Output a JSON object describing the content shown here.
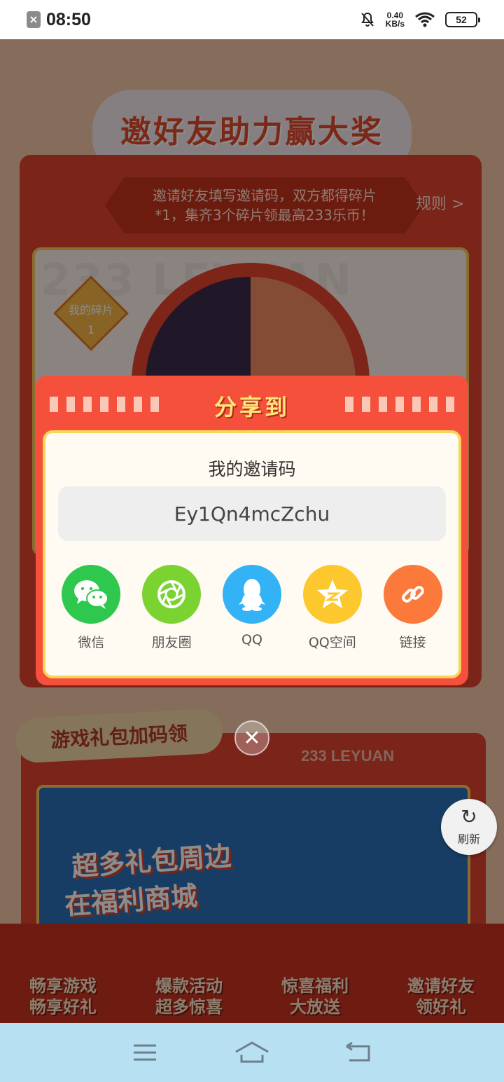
{
  "status_bar": {
    "time": "08:50",
    "net_speed_value": "0.40",
    "net_speed_unit": "KB/s",
    "battery": "52"
  },
  "page": {
    "hero_title": "邀好友助力赢大奖",
    "banner_line1": "邀请好友填写邀请码，双方都得碎片",
    "banner_line2": "*1，集齐3个碎片领最高233乐币！",
    "rules_link": "规则 >",
    "big_text": "233 LEYUAN",
    "my_fragments_label": "我的碎片",
    "my_fragments_count": "1",
    "section2_tag": "游戏礼包加码领",
    "section2_brand": "233 LEYUAN",
    "promo_line1": "超多礼包周边",
    "promo_line2": "在福利商城",
    "features": [
      {
        "line1": "畅享游戏",
        "line2": "畅享好礼"
      },
      {
        "line1": "爆款活动",
        "line2": "超多惊喜"
      },
      {
        "line1": "惊喜福利",
        "line2": "大放送"
      },
      {
        "line1": "邀请好友",
        "line2": "领好礼"
      }
    ],
    "refresh_label": "刷新"
  },
  "modal": {
    "title": "分享到",
    "code_label": "我的邀请码",
    "code_value": "Ey1Qn4mcZchu",
    "share_targets": [
      {
        "label": "微信",
        "icon": "wechat-icon",
        "color": "#2dc84d"
      },
      {
        "label": "朋友圈",
        "icon": "moments-icon",
        "color": "#7bd331"
      },
      {
        "label": "QQ",
        "icon": "qq-icon",
        "color": "#33b3f5"
      },
      {
        "label": "QQ空间",
        "icon": "qzone-icon",
        "color": "#fdc72e"
      },
      {
        "label": "链接",
        "icon": "link-icon",
        "color": "#fb7a3b"
      }
    ]
  },
  "colors": {
    "modal_red": "#f5503c",
    "title_yellow": "#ffe77a",
    "nav_bar": "#b8e0f3"
  }
}
